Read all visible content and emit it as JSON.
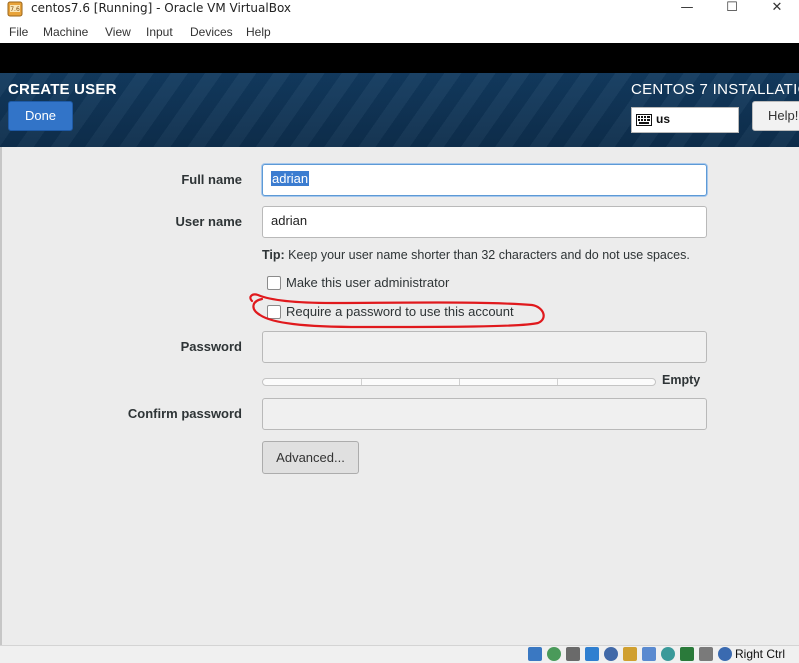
{
  "window": {
    "title": "centos7.6 [Running] - Oracle VM VirtualBox",
    "minimize": "—",
    "maximize": "☐",
    "close": "✕"
  },
  "menu": [
    "File",
    "Machine",
    "View",
    "Input",
    "Devices",
    "Help"
  ],
  "header": {
    "screen_title": "CREATE USER",
    "done_label": "Done",
    "install_title": "CENTOS 7 INSTALLATIO",
    "keyboard_layout": "us",
    "help_label": "Help!"
  },
  "form": {
    "full_name_label": "Full name",
    "full_name_value": "adrian",
    "user_name_label": "User name",
    "user_name_value": "adrian",
    "tip_bold": "Tip:",
    "tip_text": " Keep your user name shorter than 32 characters and do not use spaces.",
    "admin_checkbox_label": "Make this user administrator",
    "admin_checked": false,
    "require_password_label": "Require a password to use this account",
    "require_password_checked": false,
    "password_label": "Password",
    "password_value": "",
    "strength_label": "Empty",
    "strength_level": 0,
    "confirm_password_label": "Confirm password",
    "confirm_password_value": "",
    "advanced_label": "Advanced..."
  },
  "annotation": {
    "color": "#e0191d"
  },
  "statusbar": {
    "icons": [
      "hard-disk-icon",
      "optical-drive-icon",
      "audio-icon",
      "network-icon",
      "usb-icon",
      "shared-folders-icon",
      "display-icon",
      "video-capture-icon",
      "recording-icon",
      "cpu-icon",
      "mouse-integration-icon",
      "keyboard-capture-icon"
    ],
    "host_key": "Right Ctrl"
  },
  "colors": {
    "accent": "#3274c8",
    "header_bg": "#0d2d4b",
    "content_bg": "#ececec"
  }
}
